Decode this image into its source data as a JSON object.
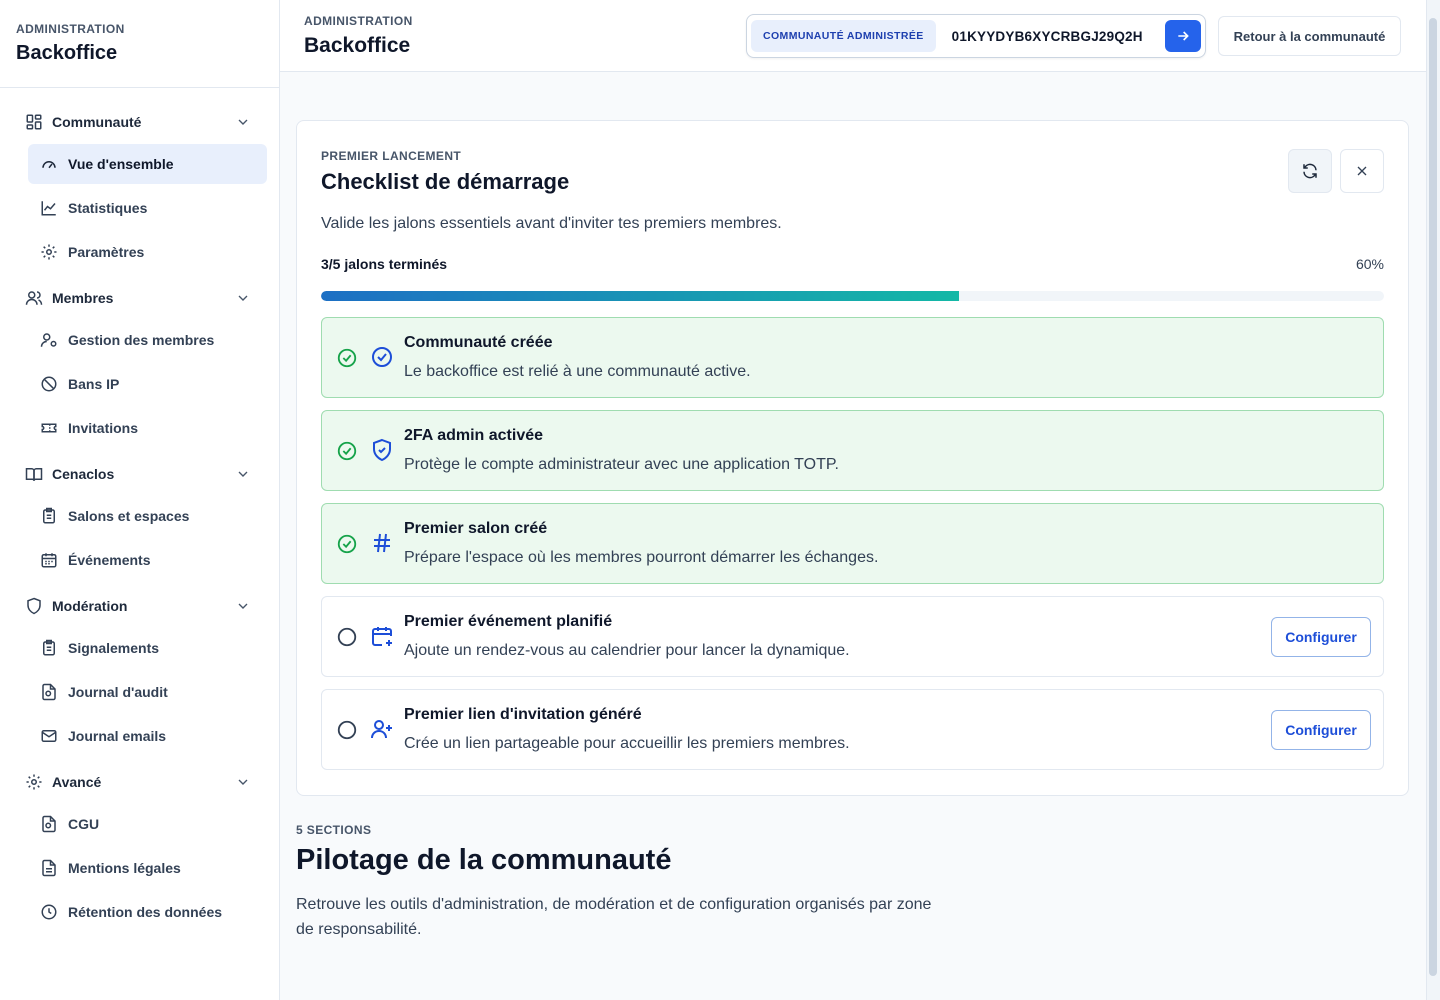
{
  "sidebar": {
    "eyebrow": "ADMINISTRATION",
    "title": "Backoffice",
    "groups": [
      {
        "label": "Communauté",
        "items": [
          "Vue d'ensemble",
          "Statistiques",
          "Paramètres"
        ]
      },
      {
        "label": "Membres",
        "items": [
          "Gestion des membres",
          "Bans IP",
          "Invitations"
        ]
      },
      {
        "label": "Cenaclos",
        "items": [
          "Salons et espaces",
          "Événements"
        ]
      },
      {
        "label": "Modération",
        "items": [
          "Signalements",
          "Journal d'audit",
          "Journal emails"
        ]
      },
      {
        "label": "Avancé",
        "items": [
          "CGU",
          "Mentions légales",
          "Rétention des données"
        ]
      }
    ],
    "active_item": "Vue d'ensemble"
  },
  "topbar": {
    "eyebrow": "ADMINISTRATION",
    "title": "Backoffice",
    "community_badge": "COMMUNAUTÉ ADMINISTRÉE",
    "community_id": "01KYYDYB6XYCRBGJ29Q2H",
    "back_label": "Retour à la communauté"
  },
  "checklist": {
    "eyebrow": "PREMIER LANCEMENT",
    "title": "Checklist de démarrage",
    "description": "Valide les jalons essentiels avant d'inviter tes premiers membres.",
    "progress_label": "3/5 jalons terminés",
    "progress_pct_label": "60%",
    "progress_value": 0.6,
    "steps": [
      {
        "title": "Communauté créée",
        "desc": "Le backoffice est relié à une communauté active.",
        "done": true,
        "icon": "check-circle-icon"
      },
      {
        "title": "2FA admin activée",
        "desc": "Protège le compte administrateur avec une application TOTP.",
        "done": true,
        "icon": "shield-check-icon"
      },
      {
        "title": "Premier salon créé",
        "desc": "Prépare l'espace où les membres pourront démarrer les échanges.",
        "done": true,
        "icon": "hash-icon"
      },
      {
        "title": "Premier événement planifié",
        "desc": "Ajoute un rendez-vous au calendrier pour lancer la dynamique.",
        "done": false,
        "icon": "calendar-plus-icon",
        "action": "Configurer"
      },
      {
        "title": "Premier lien d'invitation généré",
        "desc": "Crée un lien partageable pour accueillir les premiers membres.",
        "done": false,
        "icon": "user-plus-icon",
        "action": "Configurer"
      }
    ]
  },
  "pilotage": {
    "eyebrow": "5 SECTIONS",
    "title": "Pilotage de la communauté",
    "description": "Retrouve les outils d'administration, de modération et de configuration organisés par zone de responsabilité."
  },
  "colors": {
    "accent": "#2563eb",
    "done_bg": "#ecf9ef",
    "done_border": "#9fdcb0",
    "done_check": "#16a34a",
    "progress_start": "#1d6fc4",
    "progress_end": "#14b8a6"
  }
}
